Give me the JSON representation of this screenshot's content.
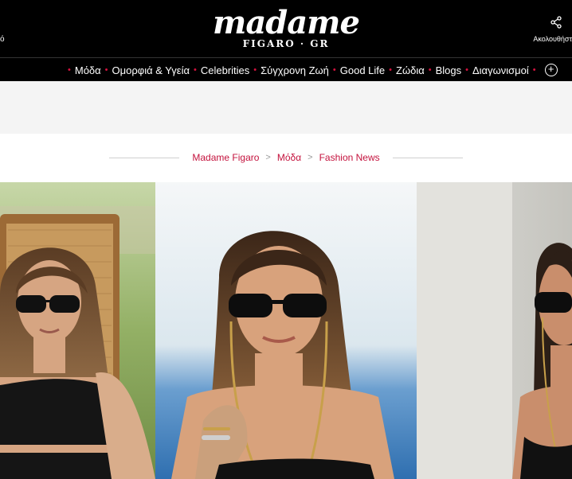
{
  "header": {
    "left_text": "ό",
    "logo_main": "madame",
    "logo_sub": "FIGARO · GR",
    "share_label": "Ακολουθήστ"
  },
  "nav": {
    "items": [
      "Μόδα",
      "Ομορφιά & Υγεία",
      "Celebrities",
      "Σύγχρονη Ζωή",
      "Good Life",
      "Ζώδια",
      "Blogs",
      "Διαγωνισμοί"
    ],
    "more_icon": "plus-circle-icon"
  },
  "breadcrumb": {
    "items": [
      "Madame Figaro",
      "Μόδα",
      "Fashion News"
    ],
    "separator": ">"
  },
  "colors": {
    "accent": "#d6123f",
    "header_bg": "#000000",
    "ad_strip": "#f4f4f4"
  }
}
